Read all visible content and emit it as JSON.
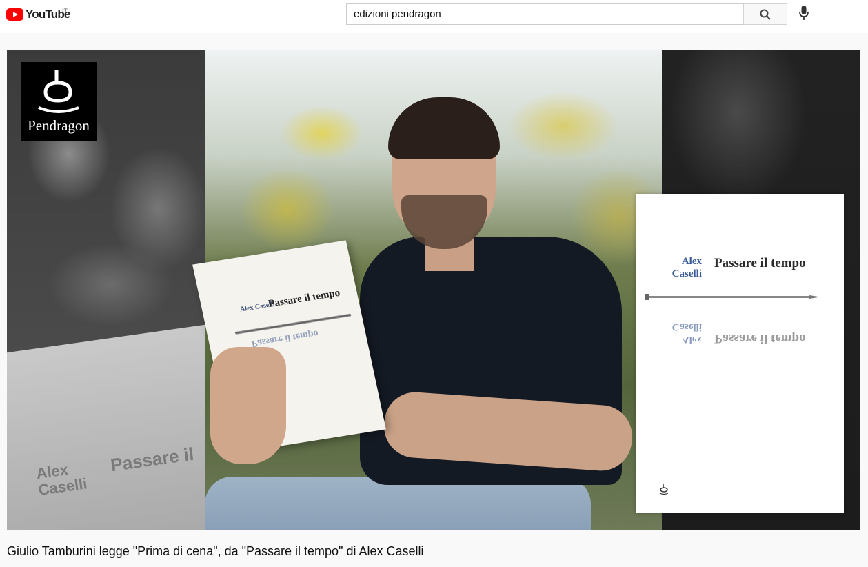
{
  "header": {
    "brand": "YouTube",
    "country_code": "IT",
    "search_value": "edizioni pendragon",
    "search_icon": "search-icon",
    "mic_icon": "microphone-icon"
  },
  "video": {
    "publisher_logo_text": "Pendragon",
    "held_book": {
      "author": "Alex Caselli",
      "title": "Passare il tempo"
    },
    "cover": {
      "author_first": "Alex",
      "author_last": "Caselli",
      "title": "Passare il tempo"
    },
    "blurred_title_fragment": "Passare il",
    "blurred_author_fragment": "Alex Caselli"
  },
  "title": "Giulio Tamburini legge \"Prima di cena\", da \"Passare il tempo\" di Alex Caselli",
  "colors": {
    "brand_red": "#ff0000",
    "cover_author_blue": "#3a5a96"
  }
}
